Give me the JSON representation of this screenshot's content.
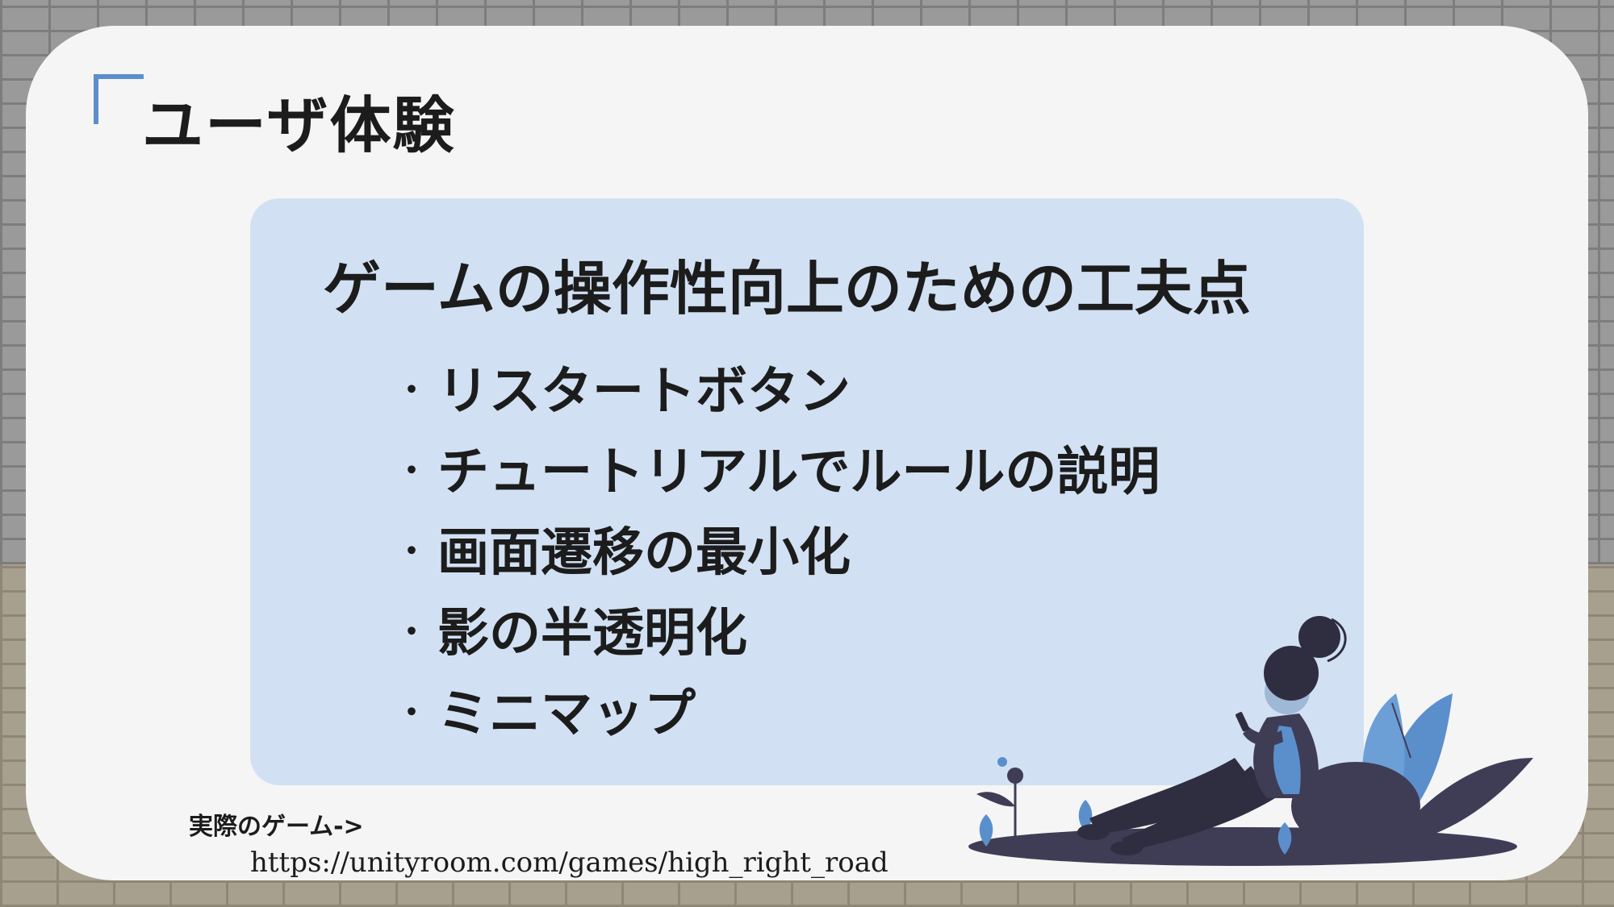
{
  "slide": {
    "title": "ユーザ体験",
    "panel_heading": "ゲームの操作性向上のための工夫点",
    "bullets": [
      "リスタートボタン",
      "チュートリアルでルールの説明",
      "画面遷移の最小化",
      "影の半透明化",
      "ミニマップ"
    ],
    "bullet_symbol": "・",
    "game_label": "実際のゲーム->",
    "game_url": "https://unityroom.com/games/high_right_road"
  },
  "colors": {
    "accent": "#5b8fcc",
    "panel": "#c4daf2",
    "text": "#1c1c1c"
  }
}
